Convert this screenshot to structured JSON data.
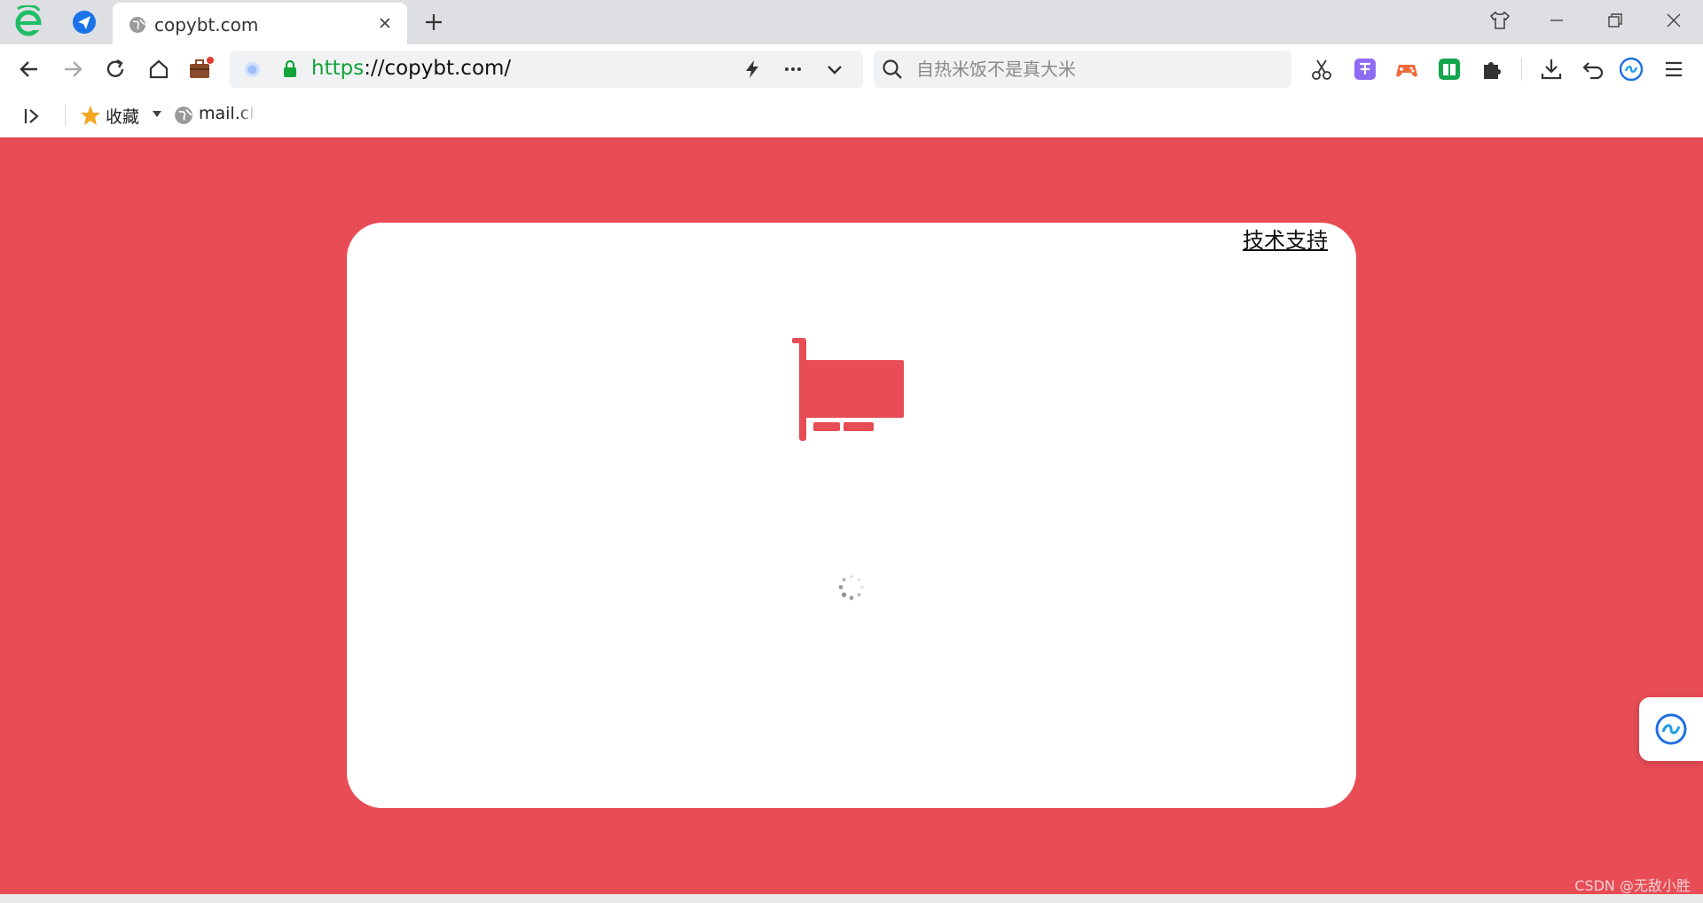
{
  "browser": {
    "tab": {
      "title": "copybt.com",
      "favicon": "globe-icon"
    },
    "address_bar": {
      "scheme": "https",
      "rest": "://copybt.com/"
    },
    "search": {
      "placeholder": "自热米饭不是真大米"
    },
    "bookmarks": {
      "favorites_label": "收藏",
      "item_mail": "mail.ch"
    },
    "colors": {
      "accent": "#12a338",
      "secure": "#12a338"
    }
  },
  "page": {
    "background_color": "#e84c55",
    "support_link": "技术支持",
    "main_icon": "network-card-icon",
    "loading": "spinner-icon"
  },
  "watermark": "CSDN @无敌小胜"
}
